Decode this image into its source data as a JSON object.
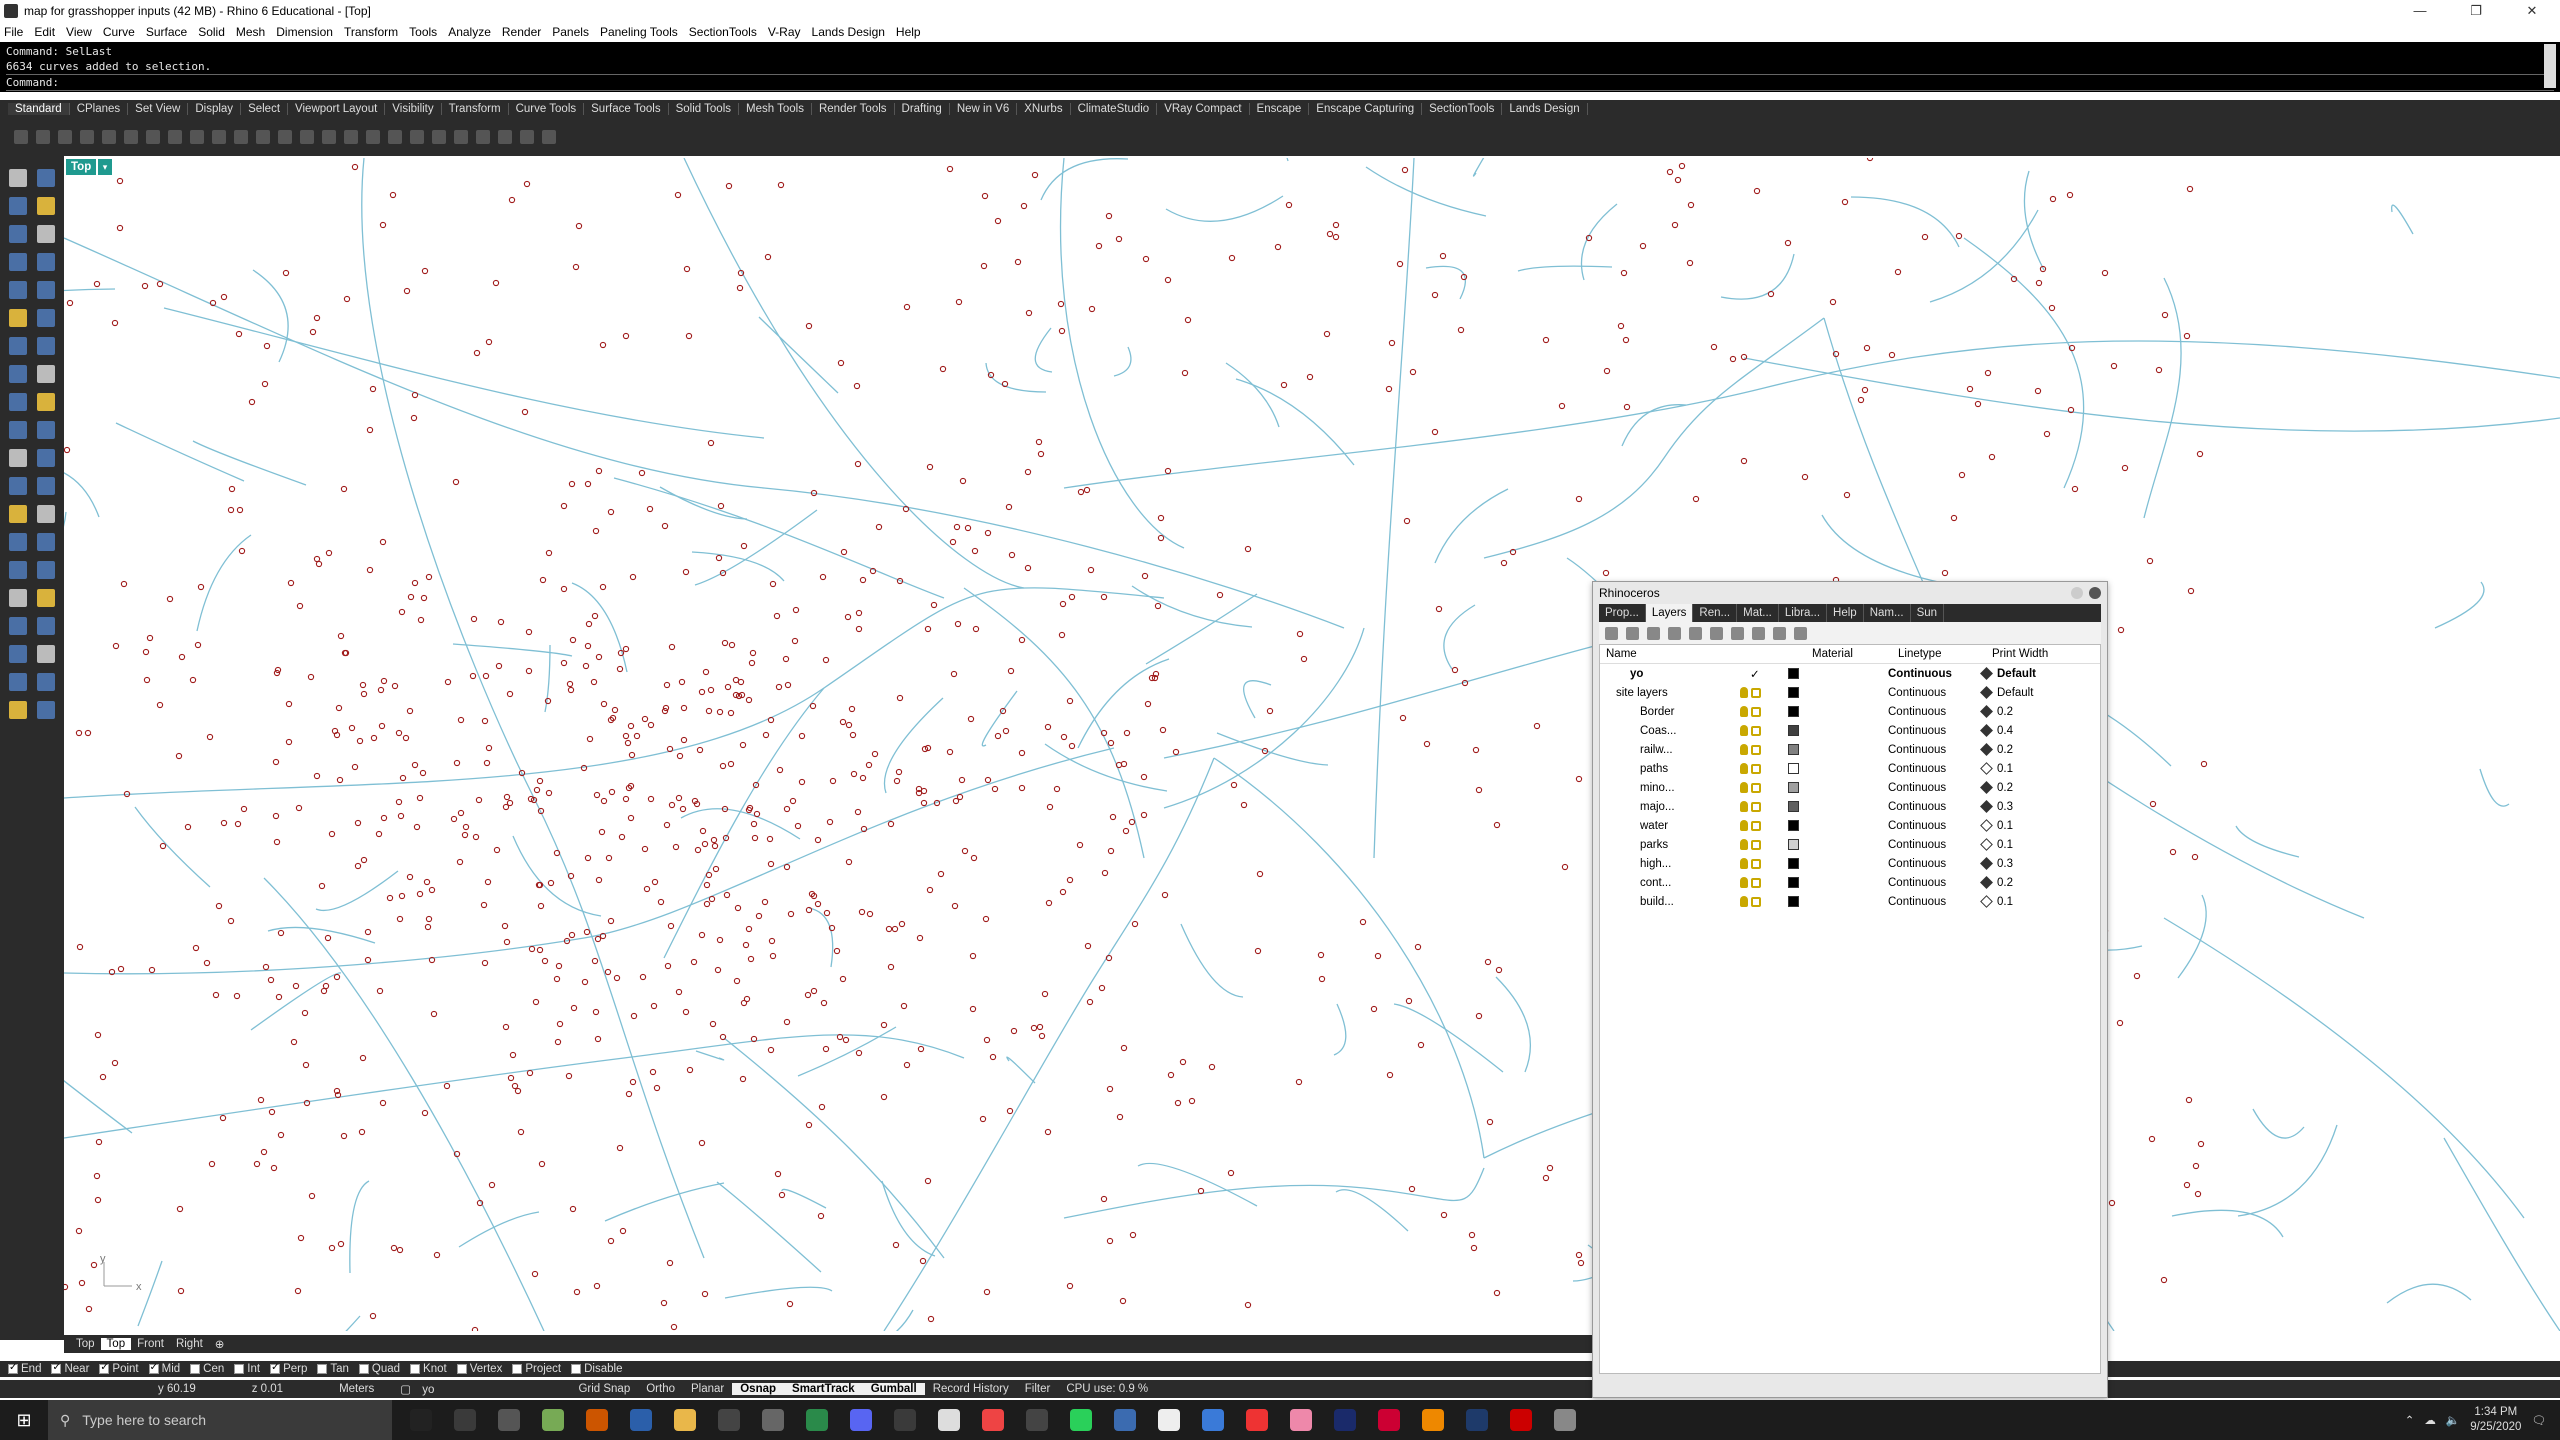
{
  "window": {
    "title": "map for grasshopper inputs (42 MB) - Rhino 6 Educational - [Top]",
    "controls": [
      "—",
      "❐",
      "✕"
    ]
  },
  "menu": [
    "File",
    "Edit",
    "View",
    "Curve",
    "Surface",
    "Solid",
    "Mesh",
    "Dimension",
    "Transform",
    "Tools",
    "Analyze",
    "Render",
    "Panels",
    "Paneling Tools",
    "SectionTools",
    "V-Ray",
    "Lands Design",
    "Help"
  ],
  "command": {
    "history": [
      "Command: SelLast",
      "6634 curves added to selection."
    ],
    "prompt": "Command:"
  },
  "toolbar_tabs": [
    "Standard",
    "CPlanes",
    "Set View",
    "Display",
    "Select",
    "Viewport Layout",
    "Visibility",
    "Transform",
    "Curve Tools",
    "Surface Tools",
    "Solid Tools",
    "Mesh Tools",
    "Render Tools",
    "Drafting",
    "New in V6",
    "XNurbs",
    "ClimateStudio",
    "VRay Compact",
    "Enscape",
    "Enscape Capturing",
    "SectionTools",
    "Lands Design"
  ],
  "viewport": {
    "name": "Top",
    "axis_y": "y",
    "axis_x": "x",
    "curve_color": "#7fbfd4",
    "point_color": "#a01c1c"
  },
  "viewport_tabs": [
    "Top",
    "Top",
    "Front",
    "Right",
    "⊕"
  ],
  "osnap": [
    {
      "label": "End",
      "on": true
    },
    {
      "label": "Near",
      "on": true
    },
    {
      "label": "Point",
      "on": true
    },
    {
      "label": "Mid",
      "on": true
    },
    {
      "label": "Cen",
      "on": false
    },
    {
      "label": "Int",
      "on": false
    },
    {
      "label": "Perp",
      "on": true
    },
    {
      "label": "Tan",
      "on": false
    },
    {
      "label": "Quad",
      "on": false
    },
    {
      "label": "Knot",
      "on": false
    },
    {
      "label": "Vertex",
      "on": false
    },
    {
      "label": "Project",
      "on": false
    },
    {
      "label": "Disable",
      "on": false
    }
  ],
  "status": {
    "y": "y 60.19",
    "z": "z 0.01",
    "units": "Meters",
    "layer": "yo",
    "panes": [
      "Grid Snap",
      "Ortho",
      "Planar",
      "Osnap",
      "SmartTrack",
      "Gumball",
      "Record History",
      "Filter"
    ],
    "active_panes": [
      "Osnap",
      "SmartTrack",
      "Gumball"
    ],
    "cpu": "CPU use: 0.9 %"
  },
  "layers_panel": {
    "title": "Rhinoceros",
    "tabs": [
      "Prop...",
      "Layers",
      "Ren...",
      "Mat...",
      "Libra...",
      "Help",
      "Nam...",
      "Sun"
    ],
    "active_tab": "Layers",
    "columns": [
      "Name",
      "Material",
      "Linetype",
      "Print Width"
    ],
    "layers": [
      {
        "name": "yo",
        "current": true,
        "color": "#000000",
        "linetype": "Continuous",
        "print_width": "Default",
        "sub": false
      },
      {
        "name": "site layers",
        "current": false,
        "color": "#000000",
        "linetype": "Continuous",
        "print_width": "Default",
        "sub": false
      },
      {
        "name": "Border",
        "current": false,
        "color": "#000000",
        "linetype": "Continuous",
        "print_width": "0.2",
        "sub": true
      },
      {
        "name": "Coas...",
        "current": false,
        "color": "#404040",
        "linetype": "Continuous",
        "print_width": "0.4",
        "sub": true
      },
      {
        "name": "railw...",
        "current": false,
        "color": "#808080",
        "linetype": "Continuous",
        "print_width": "0.2",
        "sub": true
      },
      {
        "name": "paths",
        "current": false,
        "color": "#ffffff",
        "linetype": "Continuous",
        "print_width": "0.1",
        "sub": true
      },
      {
        "name": "mino...",
        "current": false,
        "color": "#a0a0a0",
        "linetype": "Continuous",
        "print_width": "0.2",
        "sub": true
      },
      {
        "name": "majo...",
        "current": false,
        "color": "#606060",
        "linetype": "Continuous",
        "print_width": "0.3",
        "sub": true
      },
      {
        "name": "water",
        "current": false,
        "color": "#000000",
        "linetype": "Continuous",
        "print_width": "0.1",
        "sub": true
      },
      {
        "name": "parks",
        "current": false,
        "color": "#d0d0d0",
        "linetype": "Continuous",
        "print_width": "0.1",
        "sub": true
      },
      {
        "name": "high...",
        "current": false,
        "color": "#000000",
        "linetype": "Continuous",
        "print_width": "0.3",
        "sub": true
      },
      {
        "name": "cont...",
        "current": false,
        "color": "#000000",
        "linetype": "Continuous",
        "print_width": "0.2",
        "sub": true
      },
      {
        "name": "build...",
        "current": false,
        "color": "#000000",
        "linetype": "Continuous",
        "print_width": "0.1",
        "sub": true
      }
    ]
  },
  "taskbar": {
    "search_placeholder": "Type here to search",
    "time": "1:34 PM",
    "date": "9/25/2020"
  }
}
